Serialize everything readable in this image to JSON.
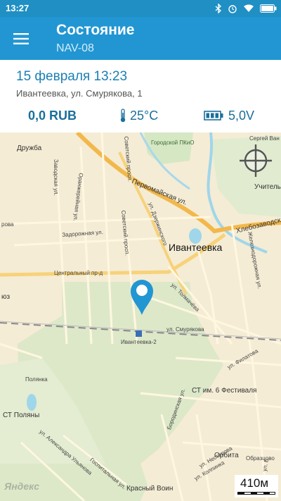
{
  "status_bar": {
    "time": "13:27",
    "icons": [
      "bluetooth-icon",
      "alarm-icon",
      "wifi-icon",
      "battery-icon"
    ]
  },
  "app_bar": {
    "title": "Состояние",
    "subtitle": "NAV-08",
    "menu_icon": "hamburger-menu-icon"
  },
  "info": {
    "date": "15 февраля 13:23",
    "address": "Ивантеевка, ул. Смурякова, 1",
    "balance": "0,0 RUB",
    "temperature": "25°C",
    "voltage": "5,0V"
  },
  "map": {
    "labels": {
      "druzhba": "Дружба",
      "zavodskaya": "Заводская ул.",
      "oranzhereynaya": "Оранжерейная ул.",
      "zadorozhnaya": "Задорожная ул.",
      "sovetsky_top": "Советский просп.",
      "sovetsky_bottom": "Советский просп.",
      "gorodskoy": "Городской ПКиО",
      "pervomayskaya": "Первомайская ул.",
      "dzerzhinskogo": "ул. Дзержинского",
      "khlebozavod": "Хлебозаводская",
      "zheleznodorozhnaya": "Железнодорожная ул.",
      "ivanteevka": "Ивантеевка",
      "tsentralny": "Центральный пр-д",
      "tolmacheva": "ул. Толмачёва",
      "smuryakova": "ул. Смурякова",
      "station": "Ивантеевка-2",
      "filatova": "ул. Филатова",
      "polyanka": "Полянка",
      "st_polyany": "СТ Поляны",
      "st6": "СТ им. 6 Фестиваля",
      "alexandra": "ул. Александра Ульянова",
      "gospitalnaya": "Госпитальная ул.",
      "borodinskaya": "Бородинская ул.",
      "nesterova": "ул. Нестерова",
      "kolpinka": "ул. Колпинка",
      "orbita": "Орбита",
      "obraztsovo": "Образцово",
      "krasny_voin": "Красный Воин",
      "sergey": "Сергей Ван",
      "uchitel": "Учитель",
      "rova": "рова",
      "yu": "юз",
      "y_ex": "ул. Е"
    },
    "locate_icon": "crosshair-locate-icon",
    "marker_icon": "map-pin-icon",
    "logo": "Яндекс",
    "scale": "410м"
  }
}
